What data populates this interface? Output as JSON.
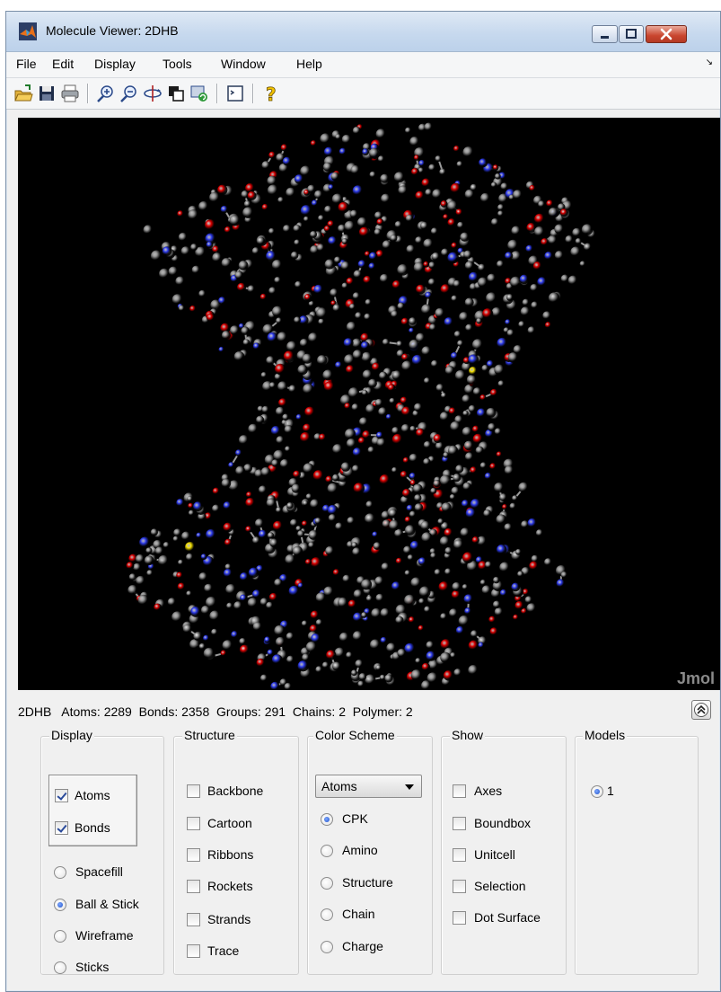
{
  "window": {
    "title": "Molecule Viewer: 2DHB"
  },
  "menu": {
    "items": [
      "File",
      "Edit",
      "Display",
      "Tools",
      "Window",
      "Help"
    ]
  },
  "toolbar": {
    "buttons": [
      "open-icon",
      "save-icon",
      "print-icon",
      "zoom-in-icon",
      "zoom-out-icon",
      "rotate-icon",
      "copy-figure-icon",
      "refresh-icon",
      "console-icon",
      "help-icon"
    ]
  },
  "viewer": {
    "logo": "Jmol",
    "atom_colors": {
      "carbon": "#8c8c8c",
      "oxygen": "#e00000",
      "nitrogen": "#2f3df0",
      "sulfur": "#f4e000",
      "background": "#000000"
    }
  },
  "status": {
    "text": "2DHB   Atoms: 2289  Bonds: 2358  Groups: 291  Chains: 2  Polymer: 2"
  },
  "display": {
    "title": "Display",
    "checkboxes": [
      {
        "label": "Atoms",
        "checked": true
      },
      {
        "label": "Bonds",
        "checked": true
      }
    ],
    "radios": [
      {
        "label": "Spacefill",
        "selected": false
      },
      {
        "label": "Ball & Stick",
        "selected": true
      },
      {
        "label": "Wireframe",
        "selected": false
      },
      {
        "label": "Sticks",
        "selected": false
      }
    ]
  },
  "structure": {
    "title": "Structure",
    "items": [
      {
        "label": "Backbone",
        "checked": false
      },
      {
        "label": "Cartoon",
        "checked": false
      },
      {
        "label": "Ribbons",
        "checked": false
      },
      {
        "label": "Rockets",
        "checked": false
      },
      {
        "label": "Strands",
        "checked": false
      },
      {
        "label": "Trace",
        "checked": false
      }
    ]
  },
  "color_scheme": {
    "title": "Color Scheme",
    "dropdown_value": "Atoms",
    "radios": [
      {
        "label": "CPK",
        "selected": true
      },
      {
        "label": "Amino",
        "selected": false
      },
      {
        "label": "Structure",
        "selected": false
      },
      {
        "label": "Chain",
        "selected": false
      },
      {
        "label": "Charge",
        "selected": false
      }
    ]
  },
  "show": {
    "title": "Show",
    "items": [
      {
        "label": "Axes",
        "checked": false
      },
      {
        "label": "Boundbox",
        "checked": false
      },
      {
        "label": "Unitcell",
        "checked": false
      },
      {
        "label": "Selection",
        "checked": false
      },
      {
        "label": "Dot Surface",
        "checked": false
      }
    ]
  },
  "models": {
    "title": "Models",
    "radios": [
      {
        "label": "1",
        "selected": true
      }
    ]
  }
}
